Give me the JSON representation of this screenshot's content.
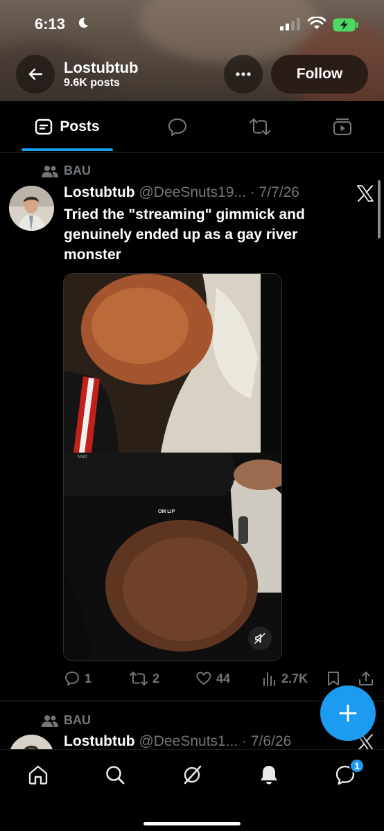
{
  "status_bar": {
    "time": "6:13"
  },
  "header": {
    "profile_name": "Lostubtub",
    "post_count": "9.6K posts",
    "follow_label": "Follow"
  },
  "tabs": [
    {
      "label": "Posts",
      "icon": "posts-icon",
      "selected": true
    },
    {
      "label": "",
      "icon": "replies-icon",
      "selected": false
    },
    {
      "label": "",
      "icon": "reposts-icon",
      "selected": false
    },
    {
      "label": "",
      "icon": "media-icon",
      "selected": false
    }
  ],
  "posts": [
    {
      "social_context": "BAU",
      "name": "Lostubtub",
      "handle": "@DeeSnuts19... · 7/7/26",
      "text": "Tried the \"streaming\" gimmick and genuinely ended up as a gay river monster",
      "media_overlay_text": "OM LIP",
      "stats": {
        "replies": "1",
        "reposts": "2",
        "likes": "44",
        "views": "2.7K"
      }
    },
    {
      "social_context": "BAU",
      "name": "Lostubtub",
      "handle": "@DeeSnuts1... · 7/6/26"
    }
  ],
  "bottom_nav": {
    "items": [
      "home-icon",
      "search-icon",
      "grok-icon",
      "notifications-icon",
      "messages-icon"
    ],
    "messages_badge": "1"
  },
  "colors": {
    "accent": "#1d9bf0",
    "muted": "#71767b",
    "follow_bg": "#2a1c16"
  }
}
